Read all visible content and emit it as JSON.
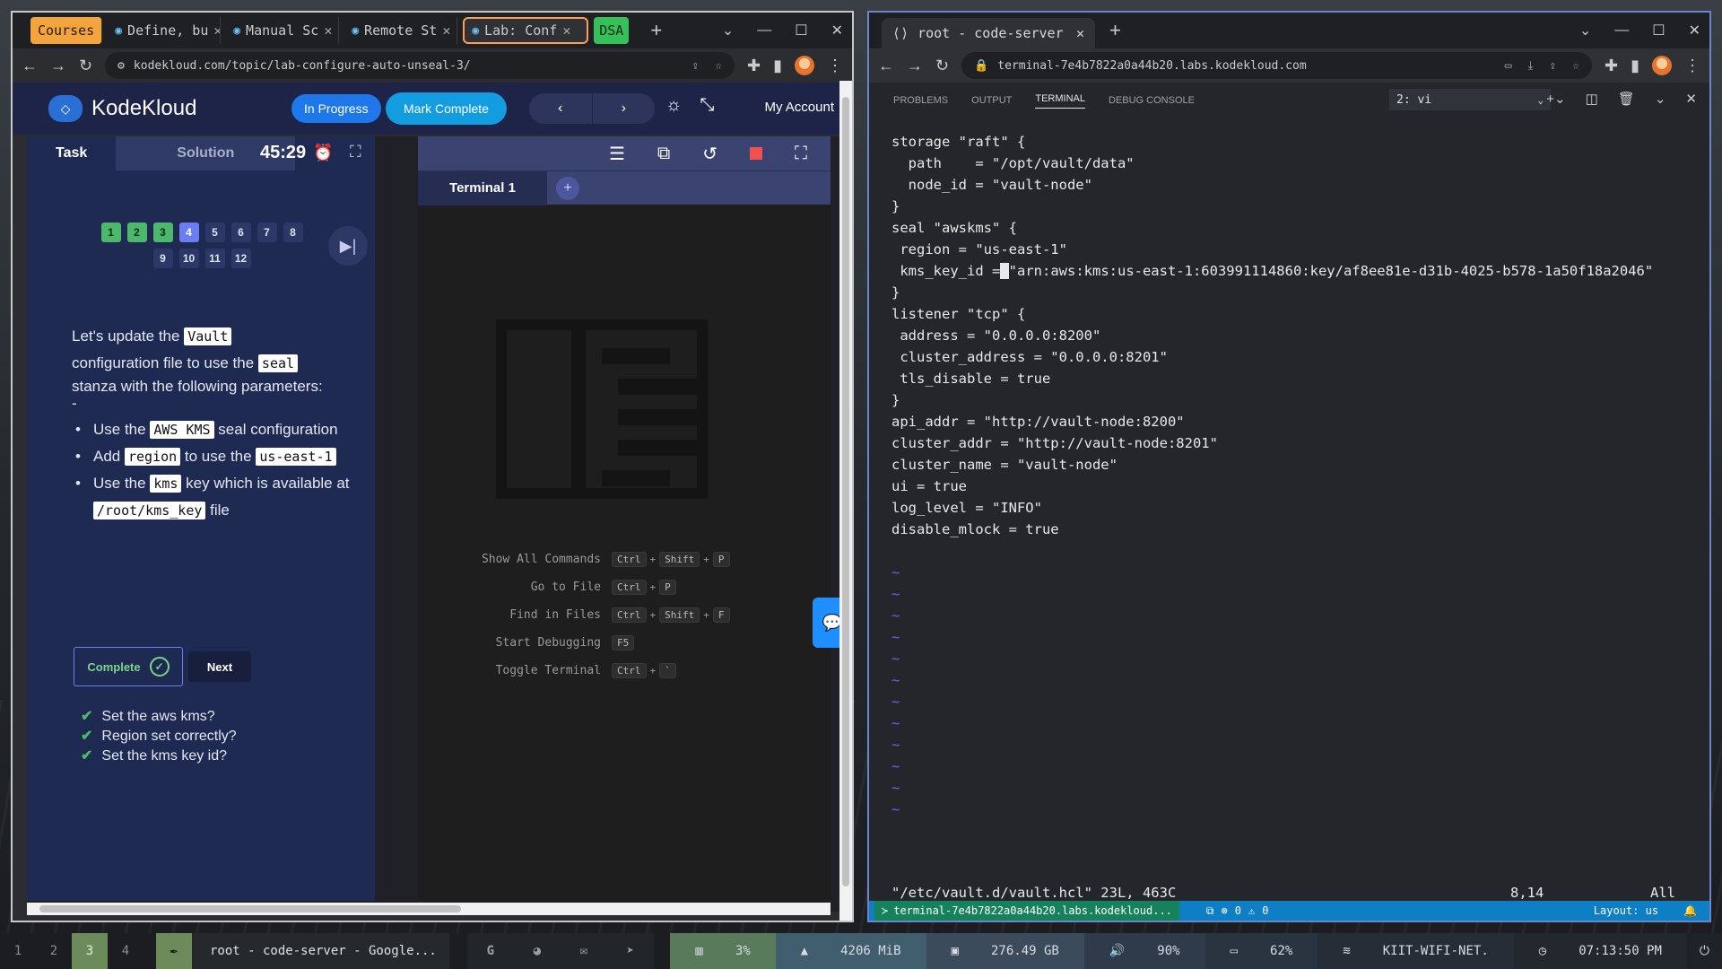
{
  "left_window": {
    "tabs": [
      {
        "label": "Courses",
        "kind": "group"
      },
      {
        "label": "Define, bu",
        "kind": "tab"
      },
      {
        "label": "Manual Sc",
        "kind": "tab"
      },
      {
        "label": "Remote St",
        "kind": "tab"
      },
      {
        "label": "Lab: Conf",
        "kind": "active"
      },
      {
        "label": "DSA",
        "kind": "group"
      }
    ],
    "url": "kodekloud.com/topic/lab-configure-auto-unseal-3/",
    "header": {
      "brand": "KodeKloud",
      "status_button": "In Progress",
      "mark_complete": "Mark Complete",
      "prev": "‹",
      "next": "›",
      "account": "My Account"
    },
    "task_panel": {
      "tab_task": "Task",
      "tab_solution": "Solution",
      "timer": "45:29",
      "steps": [
        {
          "n": "1",
          "state": "done"
        },
        {
          "n": "2",
          "state": "done"
        },
        {
          "n": "3",
          "state": "done"
        },
        {
          "n": "4",
          "state": "current"
        },
        {
          "n": "5",
          "state": "todo"
        },
        {
          "n": "6",
          "state": "todo"
        },
        {
          "n": "7",
          "state": "todo"
        },
        {
          "n": "8",
          "state": "todo"
        },
        {
          "n": "9",
          "state": "todo"
        },
        {
          "n": "10",
          "state": "todo"
        },
        {
          "n": "11",
          "state": "todo"
        },
        {
          "n": "12",
          "state": "todo"
        }
      ],
      "intro_1": "Let's update the",
      "chip_vault": "Vault",
      "intro_2": "configuration file to use the",
      "chip_seal": "seal",
      "intro_3": "stanza with the following parameters:",
      "intro_dash": "-",
      "b1_a": "Use the",
      "b1_chip": "AWS KMS",
      "b1_b": "seal configuration",
      "b2_a": "Add",
      "b2_chip1": "region",
      "b2_b": "to use the",
      "b2_chip2": "us-east-1",
      "b3_a": "Use the",
      "b3_chip": "kms",
      "b3_b": "key which is available at",
      "b3_chip2": "/root/kms_key",
      "b3_c": "file",
      "complete_btn": "Complete",
      "next_btn": "Next",
      "checks": [
        "Set the aws kms?",
        "Region set correctly?",
        "Set the kms key id?"
      ]
    },
    "terminal_panel": {
      "tab": "Terminal 1",
      "shortcuts": [
        {
          "label": "Show All Commands",
          "keys": [
            "Ctrl",
            "Shift",
            "P"
          ]
        },
        {
          "label": "Go to File",
          "keys": [
            "Ctrl",
            "P"
          ]
        },
        {
          "label": "Find in Files",
          "keys": [
            "Ctrl",
            "Shift",
            "F"
          ]
        },
        {
          "label": "Start Debugging",
          "keys": [
            "F5"
          ]
        },
        {
          "label": "Toggle Terminal",
          "keys": [
            "Ctrl",
            "`"
          ]
        }
      ]
    }
  },
  "right_window": {
    "tab_title": "root - code-server",
    "url": "terminal-7e4b7822a0a44b20.labs.kodekloud.com",
    "panel_tabs": [
      "PROBLEMS",
      "OUTPUT",
      "TERMINAL",
      "DEBUG CONSOLE"
    ],
    "active_panel_tab": "TERMINAL",
    "terminal_select": "2: vi",
    "file_lines": [
      "storage \"raft\" {",
      "  path    = \"/opt/vault/data\"",
      "  node_id = \"vault-node\"",
      "}",
      "",
      "seal \"awskms\" {",
      " region = \"us-east-1\"",
      " kms_key_id = \"arn:aws:kms:us-east-1:603991114860:key/af8ee81e-d31b-4025-b578-1a50f18a2046\"",
      "}",
      "",
      "listener \"tcp\" {",
      " address = \"0.0.0.0:8200\"",
      " cluster_address = \"0.0.0.0:8201\"",
      " tls_disable = true",
      "}",
      "",
      "api_addr = \"http://vault-node:8200\"",
      "cluster_addr = \"http://vault-node:8201\"",
      "cluster_name = \"vault-node\"",
      "ui = true",
      "log_level = \"INFO\"",
      "disable_mlock = true"
    ],
    "status_file": "\"/etc/vault.d/vault.hcl\" 23L, 463C",
    "status_pos": "8,14",
    "status_all": "All",
    "statusbar": {
      "remote": "terminal-7e4b7822a0a44b20.labs.kodekloud...",
      "errors": "0",
      "warnings": "0",
      "layout": "Layout: us"
    }
  },
  "taskbar": {
    "workspaces": [
      "1",
      "2",
      "3",
      "4"
    ],
    "active_workspace": "3",
    "app_title": "root - code-server - Google...",
    "cpu": "3%",
    "mem": "4206 MiB",
    "disk": "276.49 GB",
    "volume": "90%",
    "battery": "62%",
    "wifi": "KIIT-WIFI-NET.",
    "clock": "07:13:50 PM"
  }
}
